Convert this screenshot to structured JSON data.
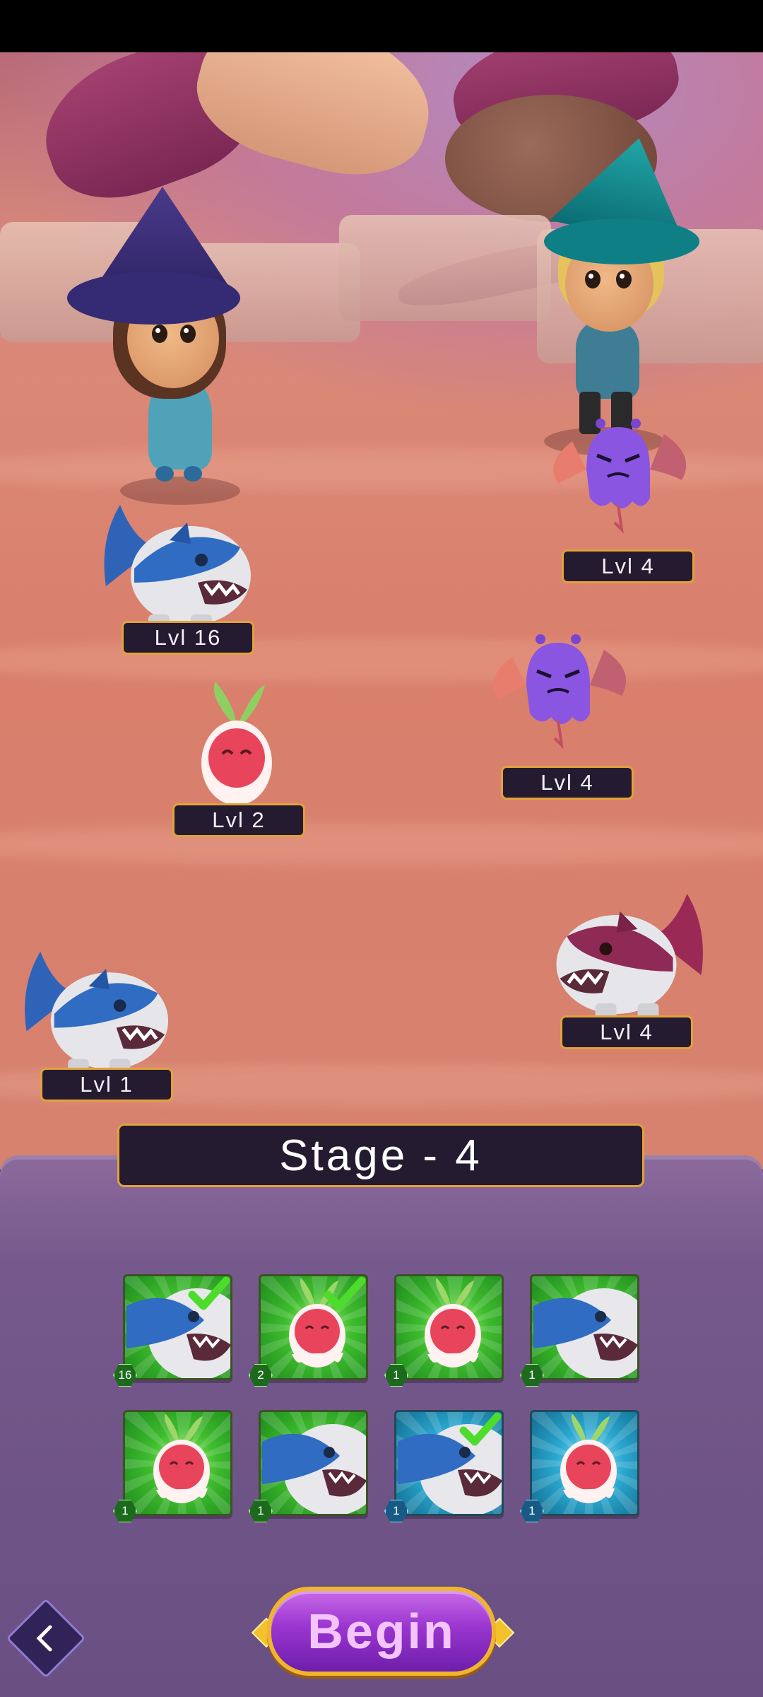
{
  "arena": {
    "player_team": [
      {
        "name": "Blue Shark",
        "level_label": "Lvl 16"
      },
      {
        "name": "Radish Sprite",
        "level_label": "Lvl 2"
      },
      {
        "name": "Blue Shark",
        "level_label": "Lvl 1"
      }
    ],
    "enemy_team": [
      {
        "name": "Purple Imp",
        "level_label": "Lvl 4"
      },
      {
        "name": "Purple Imp",
        "level_label": "Lvl 4"
      },
      {
        "name": "Crimson Shark",
        "level_label": "Lvl 4"
      }
    ]
  },
  "stage": {
    "title": "Stage - 4"
  },
  "roster": {
    "slots": [
      {
        "creature": "shark",
        "level": "16",
        "background": "green",
        "selected": true
      },
      {
        "creature": "radish",
        "level": "2",
        "background": "green",
        "selected": true
      },
      {
        "creature": "radish",
        "level": "1",
        "background": "green",
        "selected": false
      },
      {
        "creature": "shark",
        "level": "1",
        "background": "green",
        "selected": false
      },
      {
        "creature": "radish",
        "level": "1",
        "background": "green",
        "selected": false
      },
      {
        "creature": "shark",
        "level": "1",
        "background": "green",
        "selected": false
      },
      {
        "creature": "shark",
        "level": "1",
        "background": "blue",
        "selected": true
      },
      {
        "creature": "radish",
        "level": "1",
        "background": "blue",
        "selected": false
      }
    ]
  },
  "actions": {
    "begin_label": "Begin",
    "back_icon": "chevron-left-icon"
  },
  "colors": {
    "label_border": "#e2a23a",
    "label_bg": "#241b30",
    "begin_purple": "#9a35d0",
    "check_green": "#4ddc2c"
  }
}
